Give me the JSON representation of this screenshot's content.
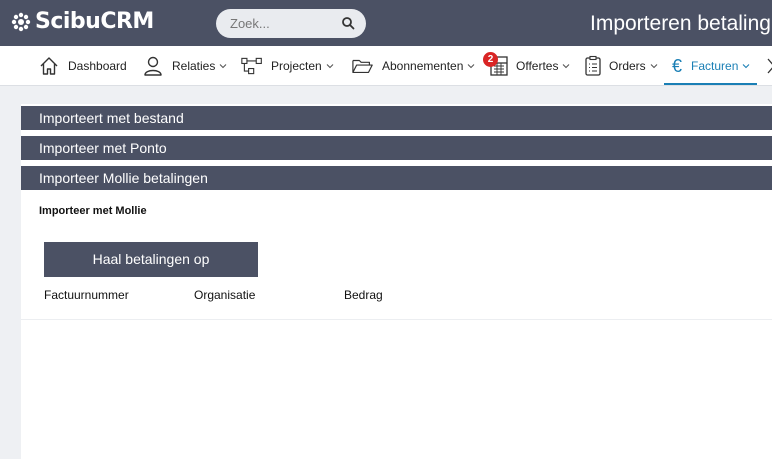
{
  "app": {
    "logo_text": "ScibuCRM",
    "page_title": "Importeren betaling"
  },
  "search": {
    "placeholder": "Zoek..."
  },
  "nav": {
    "items": [
      {
        "label": "Dashboard"
      },
      {
        "label": "Relaties"
      },
      {
        "label": "Projecten"
      },
      {
        "label": "Abonnementen"
      },
      {
        "label": "Offertes",
        "badge": "2"
      },
      {
        "label": "Orders"
      },
      {
        "label": "Facturen",
        "active": true
      }
    ]
  },
  "sections": [
    {
      "label": "Importeert met bestand"
    },
    {
      "label": "Importeer met Ponto"
    },
    {
      "label": "Importeer Mollie betalingen"
    }
  ],
  "mollie": {
    "subtitle": "Importeer met Mollie",
    "button_label": "Haal betalingen op",
    "columns": [
      "Factuurnummer",
      "Organisatie",
      "Bedrag"
    ]
  },
  "colors": {
    "header_bg": "#4b5164",
    "accent": "#1a7fb5",
    "badge": "#d92525"
  }
}
